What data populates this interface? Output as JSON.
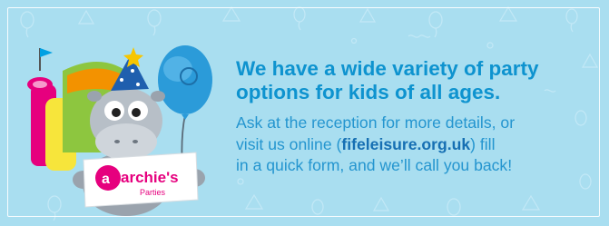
{
  "banner": {
    "headline_line1": "We have a wide variety of party",
    "headline_line2": "options for kids of all ages.",
    "body_line1": "Ask at the reception for more details, or",
    "body_line2_prefix": "visit us online (",
    "link_text": "fifeleisure.org.uk",
    "body_line2_suffix": ") fill",
    "body_line3": "in a quick form, and we’ll call you back!"
  },
  "logo": {
    "brand_name": "archie's",
    "brand_sub": "Parties"
  },
  "colors": {
    "background": "#a9def0",
    "headline": "#0e93cf",
    "body": "#2495cf",
    "link": "#166fb3",
    "logo_pink": "#e6007e"
  }
}
